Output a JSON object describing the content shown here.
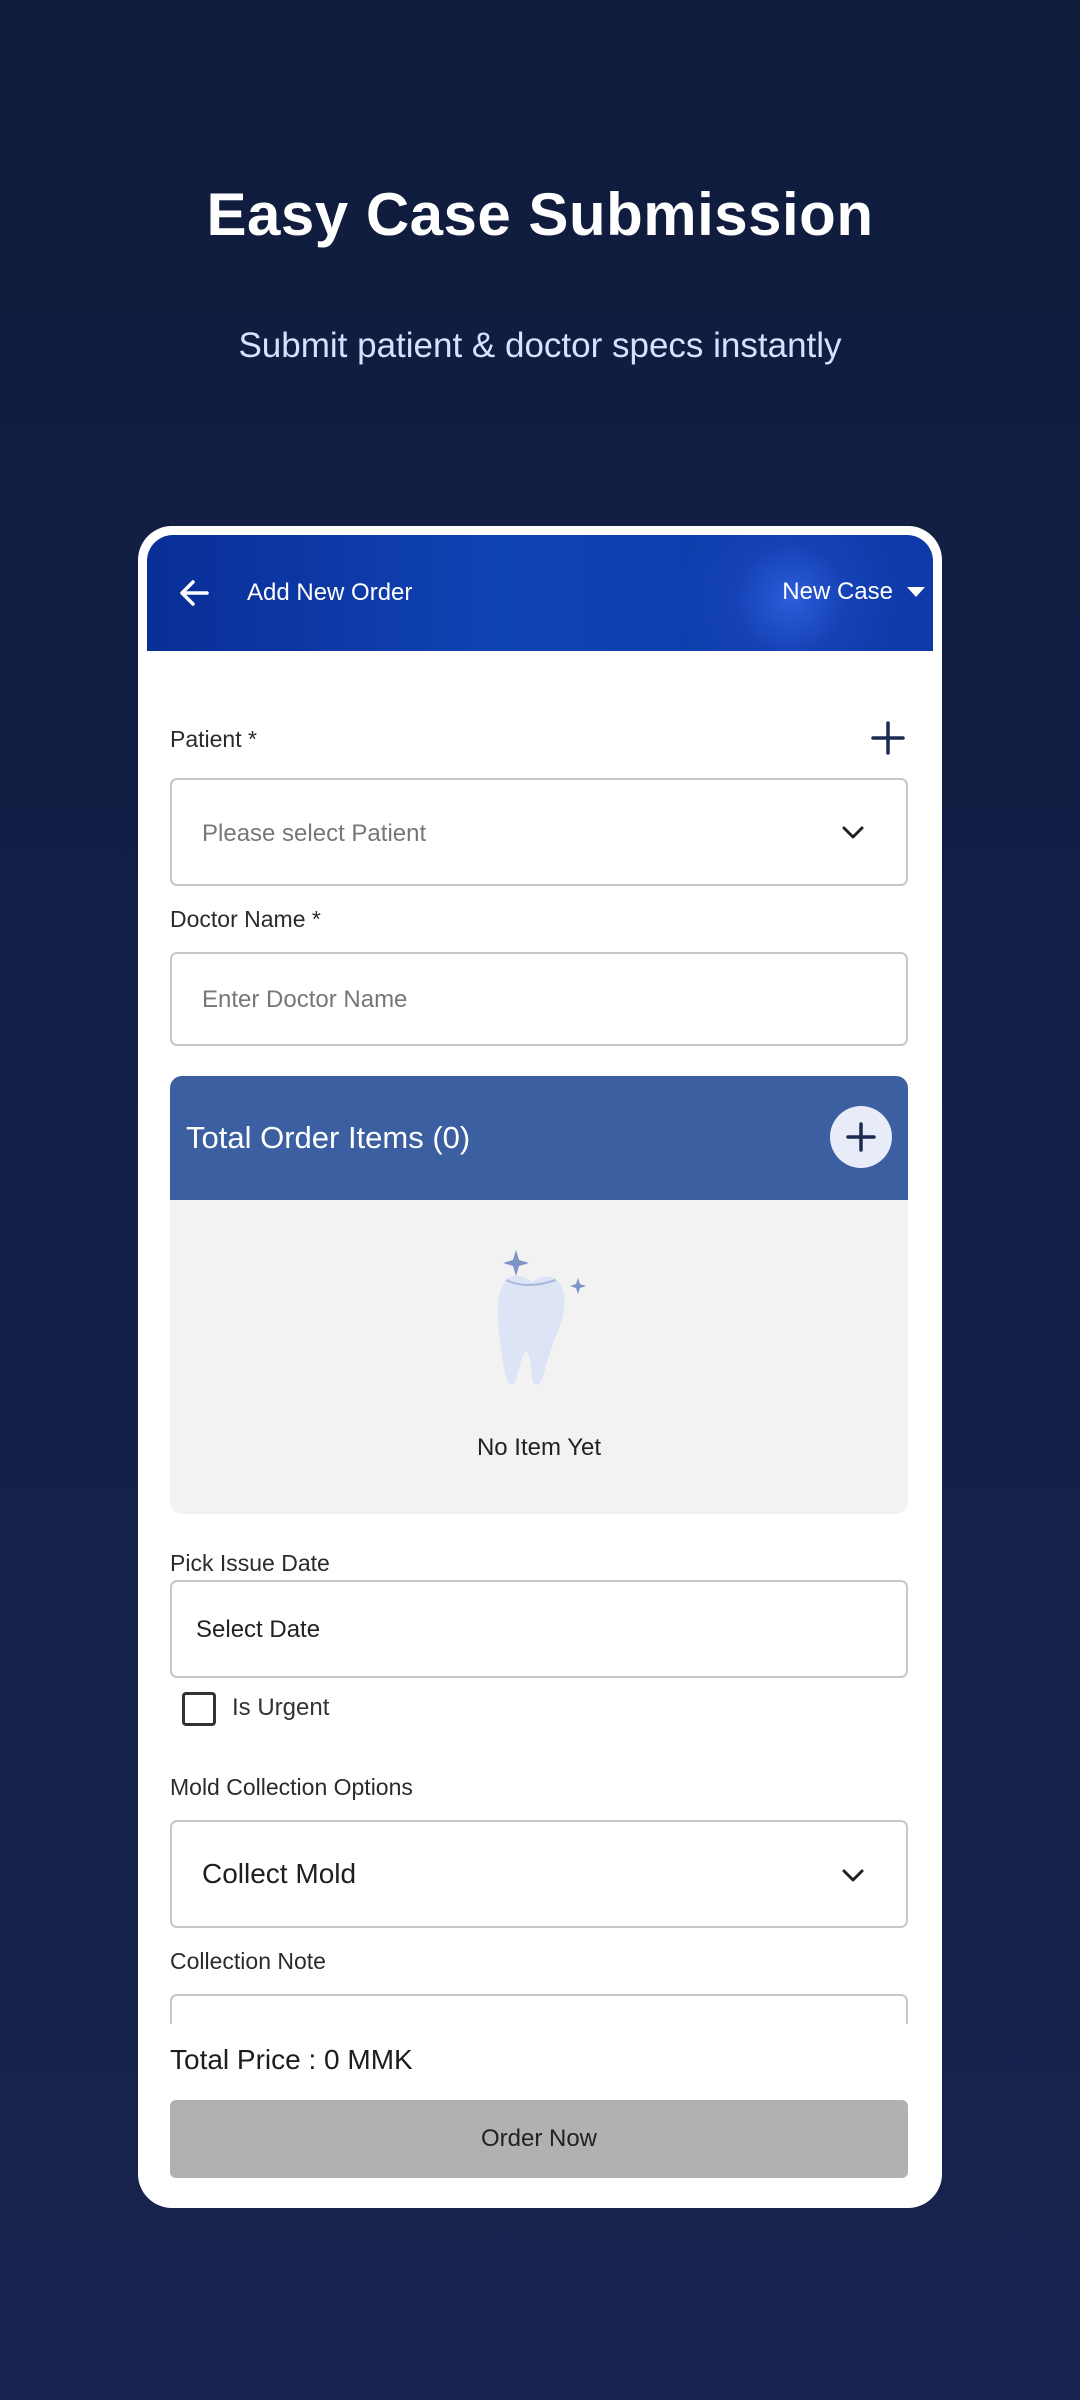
{
  "promo": {
    "headline": "Easy Case Submission",
    "subheadline": "Submit patient & doctor specs instantly"
  },
  "appbar": {
    "title": "Add New Order",
    "case_type": "New Case"
  },
  "form": {
    "patient_label": "Patient *",
    "patient_placeholder": "Please select Patient",
    "doctor_label": "Doctor Name *",
    "doctor_placeholder": "Enter Doctor Name",
    "order_items_title": "Total Order Items (0)",
    "order_items_empty": "No Item Yet",
    "issue_date_label": "Pick Issue Date",
    "issue_date_value": "Select Date",
    "urgent_label": "Is Urgent",
    "urgent_checked": false,
    "mold_label": "Mold Collection Options",
    "mold_value": "Collect Mold",
    "collection_note_label": "Collection Note",
    "collection_note_value": ""
  },
  "footer": {
    "total_price": "Total Price : 0 MMK",
    "order_button": "Order Now"
  },
  "icons": {
    "back": "arrow-left-icon",
    "case_dropdown": "caret-down-icon",
    "add_patient": "plus-icon",
    "patient_dropdown": "chevron-down-icon",
    "add_order_item": "plus-icon",
    "empty_state": "tooth-sparkle-icon",
    "mold_dropdown": "chevron-down-icon"
  },
  "colors": {
    "page_background": "#121d42",
    "appbar": "#0d3aa8",
    "order_header": "#3b5fa0",
    "order_button_disabled": "#b1b1b1"
  }
}
